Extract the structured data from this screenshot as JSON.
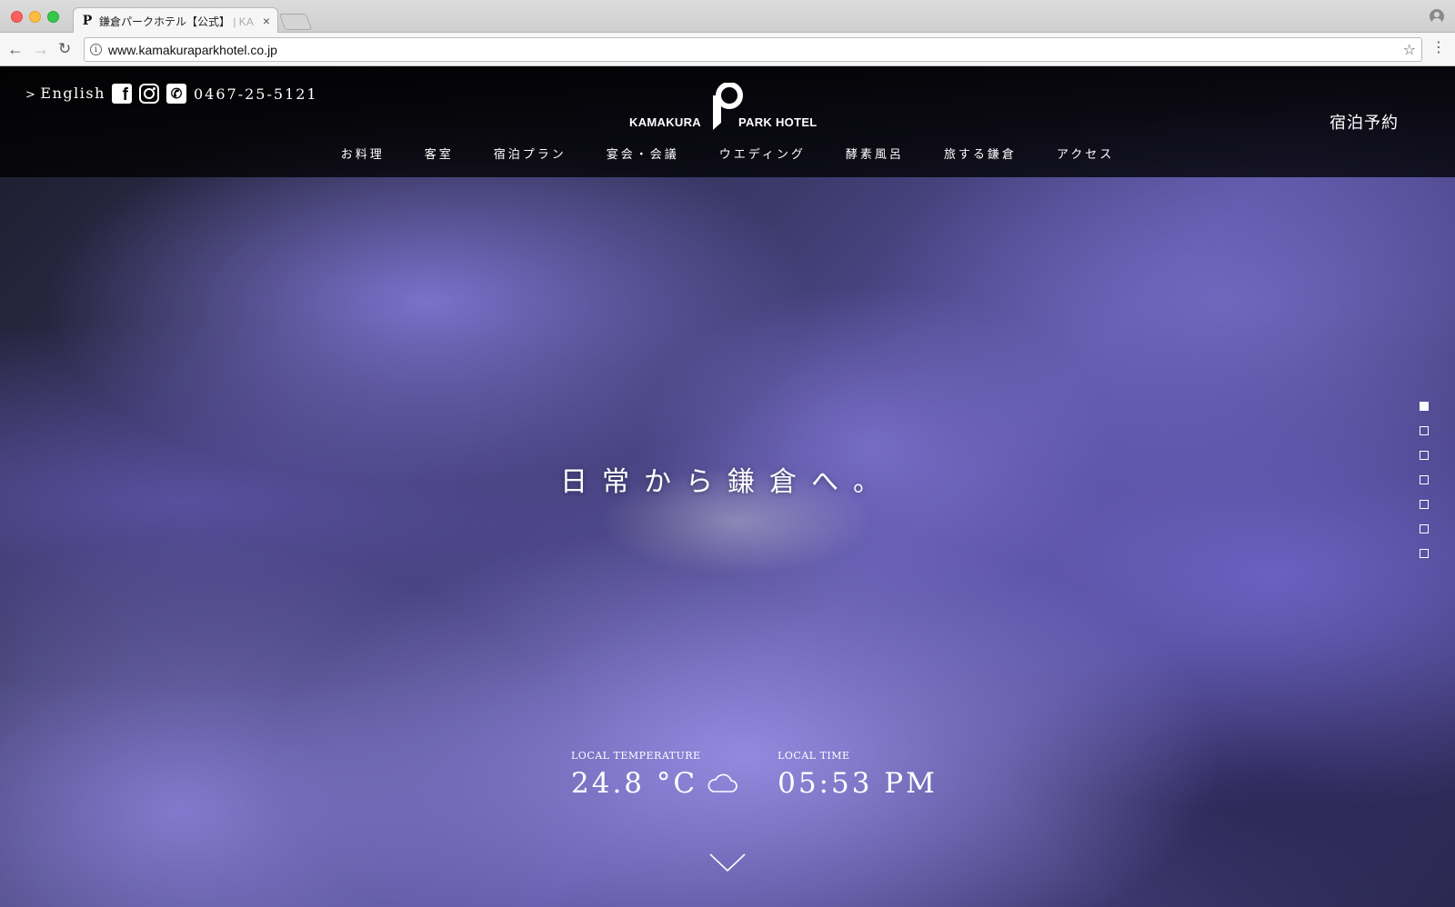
{
  "browser": {
    "tab_title": "鎌倉パークホテル【公式】",
    "tab_title_fade": "| KA",
    "tab_close": "×",
    "url": "www.kamakuraparkhotel.co.jp",
    "favicon": "P"
  },
  "header": {
    "lang_link": "English",
    "phone": "0467-25-5121",
    "logo_left": "KAMAKURA",
    "logo_right": "PARK HOTEL",
    "booking": "宿泊予約",
    "social_icons": [
      "facebook-icon",
      "instagram-icon",
      "phone-icon"
    ]
  },
  "nav": {
    "items": [
      {
        "label": "お料理"
      },
      {
        "label": "客室"
      },
      {
        "label": "宿泊プラン"
      },
      {
        "label": "宴会・会議"
      },
      {
        "label": "ウエディング"
      },
      {
        "label": "酵素風呂"
      },
      {
        "label": "旅する鎌倉"
      },
      {
        "label": "アクセス"
      }
    ]
  },
  "hero": {
    "title": "日常から鎌倉へ。",
    "slide_count": 7,
    "active_slide": 1
  },
  "weather": {
    "temp_label": "LOCAL TEMPERATURE",
    "temp_value": "24.8 °C",
    "time_label": "LOCAL TIME",
    "time_value": "05:53 PM",
    "weather_icon": "cloud-icon"
  },
  "colors": {
    "header_bg": "#000000",
    "text": "#ffffff",
    "flower_accent": "#6a60b8"
  }
}
